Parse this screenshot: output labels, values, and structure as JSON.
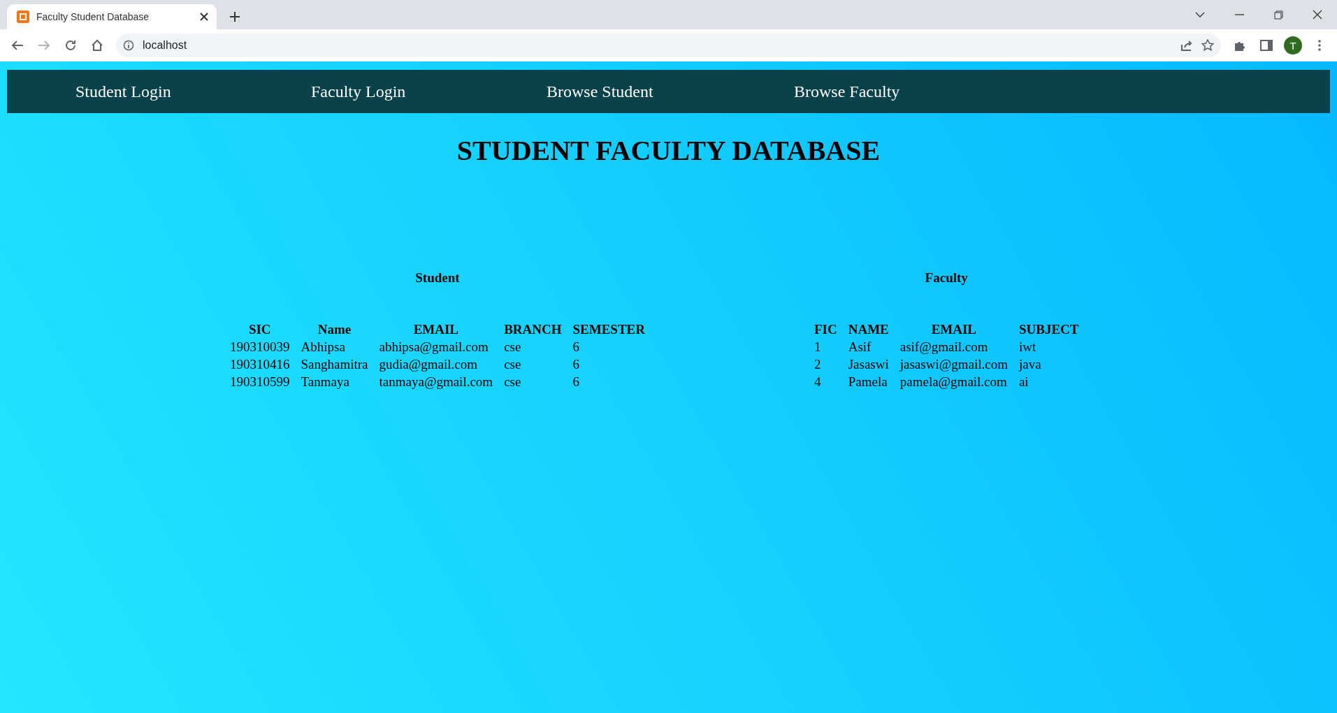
{
  "browser": {
    "tab_title": "Faculty Student Database",
    "address": "localhost",
    "avatar_letter": "T"
  },
  "nav": [
    "Student Login",
    "Faculty Login",
    "Browse Student",
    "Browse Faculty"
  ],
  "heading": "STUDENT FACULTY DATABASE",
  "tables": [
    {
      "caption": "Student",
      "columns": [
        "SIC",
        "Name",
        "EMAIL",
        "BRANCH",
        "SEMESTER"
      ],
      "rows": [
        [
          "190310039",
          "Abhipsa",
          "abhipsa@gmail.com",
          "cse",
          "6"
        ],
        [
          "190310416",
          "Sanghamitra",
          "gudia@gmail.com",
          "cse",
          "6"
        ],
        [
          "190310599",
          "Tanmaya",
          "tanmaya@gmail.com",
          "cse",
          "6"
        ]
      ]
    },
    {
      "caption": "Faculty",
      "columns": [
        "FIC",
        "NAME",
        "EMAIL",
        "SUBJECT"
      ],
      "rows": [
        [
          "1",
          "Asif",
          "asif@gmail.com",
          "iwt"
        ],
        [
          "2",
          "Jasaswi",
          "jasaswi@gmail.com",
          "java"
        ],
        [
          "4",
          "Pamela",
          "pamela@gmail.com",
          "ai"
        ]
      ]
    }
  ]
}
